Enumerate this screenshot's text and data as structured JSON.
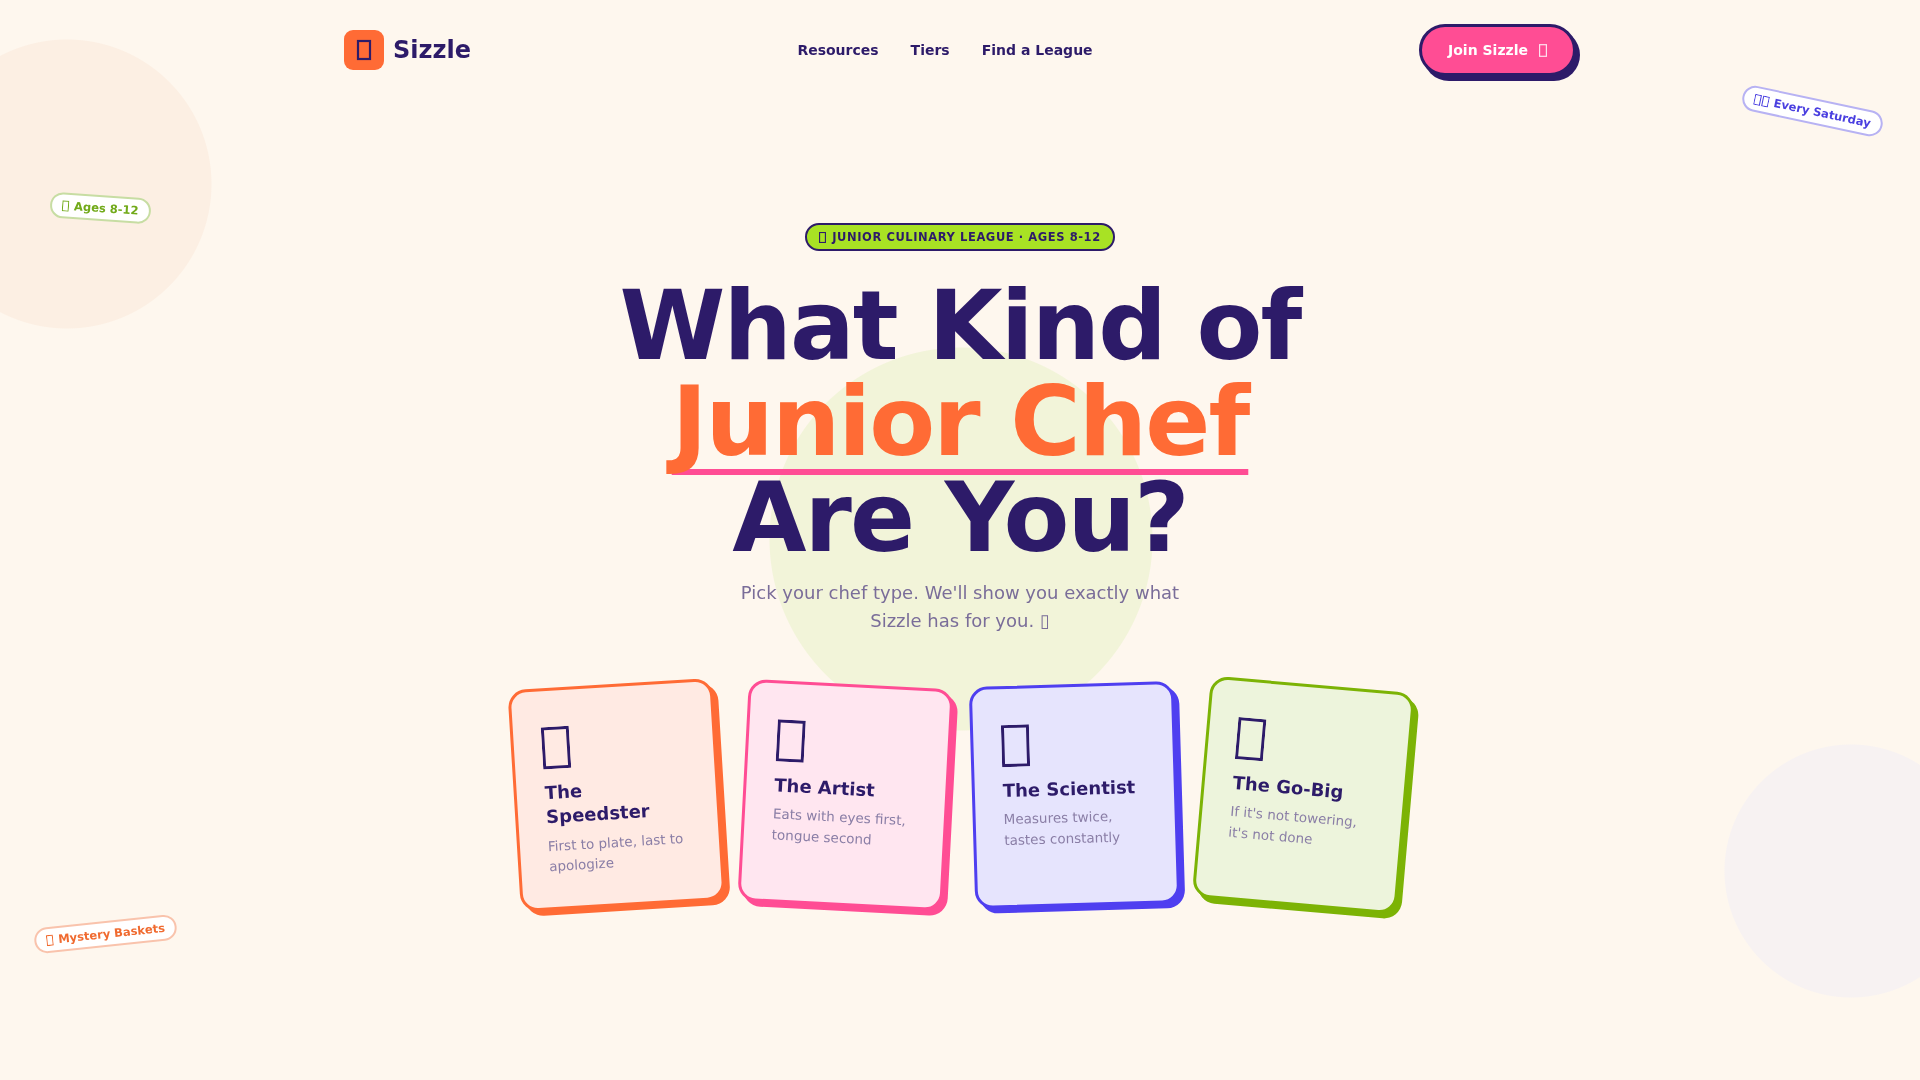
{
  "header": {
    "brand": "Sizzle",
    "nav_links": [
      "Resources",
      "Tiers",
      "Find a League"
    ],
    "cta": "Join Sizzle"
  },
  "floating_tags": [
    {
      "label": "Every Saturday",
      "color": "#4a3fe0"
    },
    {
      "label": "Ages 8-12",
      "color": "#72aa1a"
    },
    {
      "label": "Mystery Baskets",
      "color": "#f06a2f"
    }
  ],
  "hero": {
    "badge": "JUNIOR CULINARY LEAGUE · AGES 8-12",
    "heading": {
      "before": "What Kind of",
      "highlight": "Junior Chef",
      "after": "Are You?"
    },
    "subtitle": "Pick your chef type. We'll show you exactly what Sizzle has for you. ▯"
  },
  "chef_types": [
    {
      "title": "The Speedster",
      "description": "First to plate, last to apologize",
      "color": "#ff6b35"
    },
    {
      "title": "The Artist",
      "description": "Eats with eyes first, tongue second",
      "color": "#ff4d94"
    },
    {
      "title": "The Scientist",
      "description": "Measures twice, tastes constantly",
      "color": "#4f3ff0"
    },
    {
      "title": "The Go-Big",
      "description": "If it's not towering, it's not done",
      "color": "#7cb305"
    }
  ]
}
